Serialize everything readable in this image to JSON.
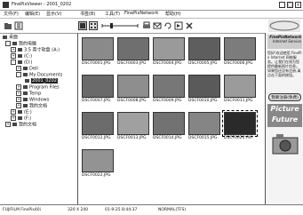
{
  "window": {
    "title": "FinePixViewer - 2001_0202",
    "min": "_",
    "max": "□",
    "close": "×"
  },
  "menu": [
    "文件(F)",
    "编辑(E)",
    "显示(V)",
    "书签(B)",
    "工具(T)",
    "FinePixNetwork",
    "帮助(H)"
  ],
  "tree": [
    {
      "label": "桌面",
      "sel": false
    },
    {
      "label": "我的电脑",
      "sel": false
    },
    {
      "label": "3.5 英寸软盘 (A:)",
      "sel": false
    },
    {
      "label": "(C:)",
      "sel": false
    },
    {
      "label": "(D:)",
      "sel": false
    },
    {
      "label": "Dell",
      "sel": false
    },
    {
      "label": "My Documents",
      "sel": false
    },
    {
      "label": "2001_0202",
      "sel": true
    },
    {
      "label": "Program Files",
      "sel": false
    },
    {
      "label": "Temp",
      "sel": false
    },
    {
      "label": "Windows",
      "sel": false
    },
    {
      "label": "我的文档",
      "sel": false
    },
    {
      "label": "(E:)",
      "sel": false
    },
    {
      "label": "(F:)",
      "sel": false
    },
    {
      "label": "我的文档",
      "sel": false
    }
  ],
  "thumbnails": [
    {
      "name": "DSCF0001.JPG",
      "color": "#8a8a8a",
      "sel": false
    },
    {
      "name": "DSCF0003.JPG",
      "color": "#6f6f6f",
      "sel": false
    },
    {
      "name": "DSCF0004.JPG",
      "color": "#9a9a9a",
      "sel": false
    },
    {
      "name": "DSCF0005.JPG",
      "color": "#5e5e5e",
      "sel": false
    },
    {
      "name": "DSCF0006.JPG",
      "color": "#7c7c7c",
      "sel": false
    },
    {
      "name": "DSCF0007.JPG",
      "color": "#6a6a6a",
      "sel": false
    },
    {
      "name": "DSCF0008.JPG",
      "color": "#8e8e8e",
      "sel": false
    },
    {
      "name": "DSCF0009.JPG",
      "color": "#777777",
      "sel": false
    },
    {
      "name": "DSCF0010.JPG",
      "color": "#5a5a5a",
      "sel": false
    },
    {
      "name": "DSCF0011.JPG",
      "color": "#9b9b9b",
      "sel": false
    },
    {
      "name": "DSCF0012.JPG",
      "color": "#6c6c6c",
      "sel": false
    },
    {
      "name": "DSCF0013.JPG",
      "color": "#a0a0a0",
      "sel": false
    },
    {
      "name": "DSCF0014.JPG",
      "color": "#727272",
      "sel": false
    },
    {
      "name": "DSCF0015.JPG",
      "color": "#858585",
      "sel": false
    },
    {
      "name": "DSCF0020.AVI",
      "color": "#2a2a2a",
      "sel": true
    },
    {
      "name": "DSCF0022.JPG",
      "color": "#939393",
      "sel": false
    }
  ],
  "right_panel": {
    "header_line1": "FinePixNetwork",
    "header_line2": "Internet Service",
    "text": "您好!欢迎使用 FinePix Internet 网络服务。让我们在线为您提供最新照片信息。如果您还没有注册,请点击下面的按钮。",
    "button": "我要注册(免费)",
    "logo_line1": "Picture",
    "logo_line2": "Future"
  },
  "status": {
    "camera": "FUJIFILM FinePix40i",
    "size": "320 X 240",
    "date": "01-9-25 8:44:37",
    "mode": "NORMAL(TFS)"
  }
}
